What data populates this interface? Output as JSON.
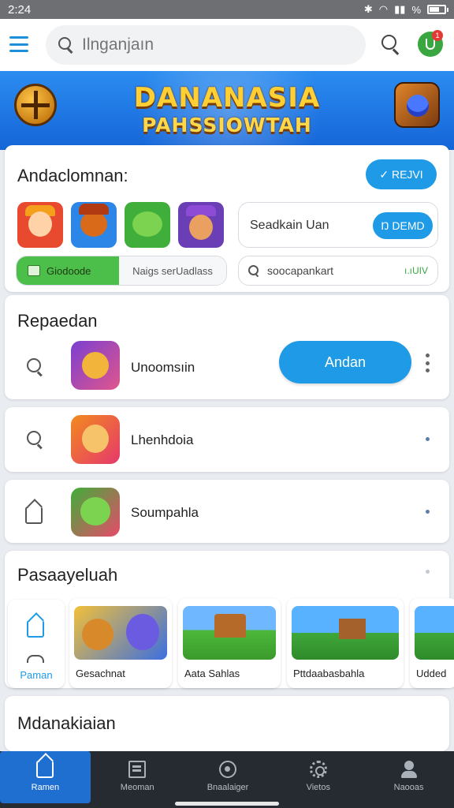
{
  "status_bar": {
    "time": "2:24",
    "battery_label": "%"
  },
  "search": {
    "placeholder": "Ilnganjaın"
  },
  "notifications": {
    "count": "1"
  },
  "banner": {
    "title_line1": "DANANASIA",
    "title_line2": "PAHSSIOWTAH"
  },
  "featured_card": {
    "heading": "Andaclomnan:",
    "new_button": "✓ REJVI",
    "search_label": "Seadkain Uan",
    "demo_button": "Ŋ DEMD",
    "tab_active": "Giodoode",
    "tab_other": "Naigs serUadlass",
    "filter_text": "soocapankart",
    "filter_value": "ı.ıUIV"
  },
  "recommended": {
    "title": "Repaedan",
    "items": [
      {
        "name": "Unoomsıin",
        "action": "Andan",
        "icon": "search-icon"
      },
      {
        "name": "Lhenhdoia",
        "icon": "search-icon"
      },
      {
        "name": "Soumpahla",
        "icon": "home-icon"
      }
    ]
  },
  "popular": {
    "title": "Pasaayeluah",
    "home_tile": "Paman",
    "games": [
      {
        "name": "Gesachnat"
      },
      {
        "name": "Aata Sahlas"
      },
      {
        "name": "Pttdaabasbahla"
      },
      {
        "name": "Udded"
      }
    ]
  },
  "more_section": {
    "title": "Mdanakiaian"
  },
  "bottom_nav": [
    {
      "label": "Ramen",
      "icon": "home-icon",
      "active": true
    },
    {
      "label": "Meoman",
      "icon": "list-icon"
    },
    {
      "label": "Bnaalaiger",
      "icon": "circle-icon"
    },
    {
      "label": "Vietos",
      "icon": "gear-icon"
    },
    {
      "label": "Naooas",
      "icon": "person-icon"
    }
  ],
  "colors": {
    "accent": "#1e9ae6",
    "banner_blue": "#1565d8",
    "banner_text": "#ffcf33",
    "green": "#4cbe4a",
    "nav_bg": "#262a31"
  }
}
